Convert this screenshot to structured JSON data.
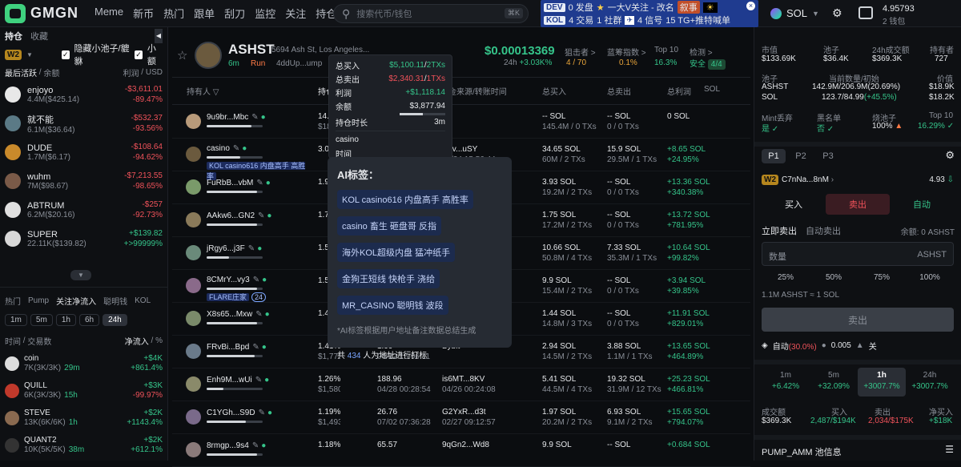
{
  "nav": {
    "brand": "GMGN",
    "items": [
      "Meme",
      "新币",
      "热门",
      "跟单",
      "刮刀",
      "监控",
      "关注",
      "持仓"
    ],
    "search_placeholder": "搜索代币/钱包",
    "search_kbd": "⌘K"
  },
  "promo": {
    "line1_tag": "DEV",
    "line1_a": "0 发盘",
    "line1_b": "一大V关注 - 改名",
    "line1_c": "叙事",
    "line2_tag": "KOL",
    "line2_a": "4 交易",
    "line2_b": "1 社群",
    "line2_c": "4 信号",
    "line2_d": "15 TG+推特喊单"
  },
  "chain": {
    "name": "SOL",
    "balance": "4.95793",
    "wallets": "2 钱包"
  },
  "left": {
    "tabs": [
      "持仓",
      "收藏"
    ],
    "wallet": "W2",
    "filter1": "隐藏小池子/貔貅",
    "filter2": "小额",
    "col1": "最后活跃",
    "col2": "余额",
    "col3": "利润",
    "col3b": "USD",
    "items": [
      {
        "name": "enjoyo",
        "sub": "4.4M($425.14)",
        "v1": "-$3,611.01",
        "v2": "-89.47%",
        "up": false
      },
      {
        "name": "就不能",
        "sub": "6.1M($36.64)",
        "v1": "-$532.37",
        "v2": "-93.56%",
        "up": false
      },
      {
        "name": "DUDE",
        "sub": "1.7M($6.17)",
        "v1": "-$108.64",
        "v2": "-94.62%",
        "up": false
      },
      {
        "name": "wuhm",
        "sub": "7M($98.67)",
        "v1": "-$7,213.55",
        "v2": "-98.65%",
        "up": false
      },
      {
        "name": "ABTRUM",
        "sub": "6.2M($20.16)",
        "v1": "-$257",
        "v2": "-92.73%",
        "up": false
      },
      {
        "name": "SUPER",
        "sub": "22.11K($139.82)",
        "v1": "+$139.82",
        "v2": "+>99999%",
        "up": true
      }
    ],
    "tabs2": [
      "热门",
      "Pump",
      "关注净流入",
      "聪明钱",
      "KOL"
    ],
    "times": [
      "1m",
      "5m",
      "1h",
      "6h",
      "24h"
    ],
    "col4": "时间",
    "col4b": "交易数",
    "col5": "净流入",
    "flows": [
      {
        "name": "coin",
        "sub": "7K(3K/3K)",
        "t": "29m",
        "v1": "+$4K",
        "v2": "+861.4%",
        "up": true
      },
      {
        "name": "QUILL",
        "sub": "6K(3K/3K)",
        "t": "15h",
        "v1": "+$3K",
        "v2": "-99.97%",
        "up": false
      },
      {
        "name": "STEVE",
        "sub": "13K(6K/6K)",
        "t": "1h",
        "v1": "+$2K",
        "v2": "+1143.4%",
        "up": true
      },
      {
        "name": "QUANT2",
        "sub": "10K(5K/5K)",
        "t": "38m",
        "v1": "+$2K",
        "v2": "+612.1%",
        "up": true
      }
    ]
  },
  "token": {
    "symbol": "ASHST",
    "addr": "5694 Ash St, Los Angeles...",
    "age": "6m",
    "run": "Run",
    "ca": "4ddUp...ump",
    "price": "$0.00013369",
    "change_label": "24h",
    "change": "+3.03K%",
    "sniper_label": "狙击者 >",
    "sniper": "4 / 70",
    "bluechip_label": "蓝筹指数 >",
    "bluechip": "0.1%",
    "top10_label": "Top 10",
    "top10": "16.3%",
    "check_label": "检测 >",
    "check": "安全",
    "check_count": "4/4"
  },
  "table": {
    "headers": [
      "持有人",
      "持仓",
      "金来源/转账时间",
      "总买入",
      "总卖出",
      "总利润",
      "SOL"
    ],
    "rows": [
      {
        "name": "9u9br...Mbc",
        "pct": "14.5",
        "usd": "$18",
        "src": "",
        "stime": "",
        "buy": "-- SOL",
        "buy2": "145.4M / 0 TXs",
        "sell": "-- SOL",
        "sell2": "0 / 0 TXs",
        "pnl": "0 SOL",
        "pnl2": "",
        "bar": 0.8
      },
      {
        "name": "casino",
        "pct": "3.04",
        "usd": "",
        "src": "Hev...uSY",
        "stime": "09/24 15:56:44",
        "buy": "34.65 SOL",
        "buy2": "60M / 2 TXs",
        "sell": "15.9 SOL",
        "sell2": "29.5M / 1 TXs",
        "pnl": "+8.65 SOL",
        "pnl2": "+24.95%",
        "bar": 0.6,
        "label": "KOL casino616 内盘高手 高胜率"
      },
      {
        "name": "FuRbB...vbM",
        "pct": "1.9",
        "usd": "",
        "src": "",
        "stime": "",
        "buy": "3.93 SOL",
        "buy2": "19.2M / 2 TXs",
        "sell": "-- SOL",
        "sell2": "0 / 0 TXs",
        "pnl": "+13.36 SOL",
        "pnl2": "+340.38%",
        "bar": 0.9
      },
      {
        "name": "AAkw6...GN2",
        "pct": "1.7",
        "usd": "",
        "src": "",
        "stime": "",
        "buy": "1.75 SOL",
        "buy2": "17.2M / 2 TXs",
        "sell": "-- SOL",
        "sell2": "0 / 0 TXs",
        "pnl": "+13.72 SOL",
        "pnl2": "+781.95%",
        "bar": 0.9
      },
      {
        "name": "jRgy6...j3F",
        "pct": "1.5",
        "usd": "",
        "src": "",
        "stime": "",
        "buy": "10.66 SOL",
        "buy2": "50.8M / 4 TXs",
        "sell": "7.33 SOL",
        "sell2": "35.3M / 1 TXs",
        "pnl": "+10.64 SOL",
        "pnl2": "+99.82%",
        "bar": 0.4
      },
      {
        "name": "8CMrY...vy3",
        "pct": "1.5",
        "usd": "",
        "src": "",
        "stime": "",
        "buy": "9.9 SOL",
        "buy2": "15.4M / 2 TXs",
        "sell": "-- SOL",
        "sell2": "0 / 0 TXs",
        "pnl": "+3.94 SOL",
        "pnl2": "+39.85%",
        "bar": 0.9,
        "label": "FLARE庄家",
        "badge": "24"
      },
      {
        "name": "X8s65...Mxw",
        "pct": "1.4",
        "usd": "",
        "src": "",
        "stime": "",
        "buy": "1.44 SOL",
        "buy2": "14.8M / 3 TXs",
        "sell": "-- SOL",
        "sell2": "0 / 0 TXs",
        "pnl": "+11.91 SOL",
        "pnl2": "+829.01%",
        "bar": 0.9
      },
      {
        "name": "FRvBi...Bpd",
        "pct": "1.41%",
        "usd": "$1,775.04",
        "amt": "1.99",
        "atime": "04/22 15:06:11",
        "src": "Bybit",
        "stime": "",
        "buy": "2.94 SOL",
        "buy2": "14.5M / 2 TXs",
        "sell": "3.88 SOL",
        "sell2": "1.1M / 1 TXs",
        "pnl": "+13.65 SOL",
        "pnl2": "+464.89%",
        "bar": 0.85
      },
      {
        "name": "Enh9M...wUi",
        "pct": "1.26%",
        "usd": "$1,580.14",
        "amt": "188.96",
        "atime": "04/28 00:28:54",
        "src": "is6MT...8KV",
        "stime": "04/26 00:24:08",
        "buy": "5.41 SOL",
        "buy2": "44.5M / 4 TXs",
        "sell": "19.32 SOL",
        "sell2": "31.9M / 12 TXs",
        "pnl": "+25.23 SOL",
        "pnl2": "+466.81%",
        "bar": 0.3
      },
      {
        "name": "C1YGh...S9D",
        "pct": "1.19%",
        "usd": "$1,493.21",
        "amt": "26.76",
        "atime": "07/02 07:36:28",
        "src": "G2YxR...d3t",
        "stime": "02/27 09:12:57",
        "buy": "1.97 SOL",
        "buy2": "20.2M / 2 TXs",
        "sell": "6.93 SOL",
        "sell2": "9.1M / 2 TXs",
        "pnl": "+15.65 SOL",
        "pnl2": "+794.07%",
        "bar": 0.7
      },
      {
        "name": "8rmgp...9s4",
        "pct": "1.18%",
        "usd": "",
        "amt": "65.57",
        "atime": "",
        "src": "9qGn2...Wd8",
        "stime": "",
        "buy": "9.9 SOL",
        "buy2": "",
        "sell": "-- SOL",
        "sell2": "",
        "pnl": "+0.684 SOL",
        "pnl2": "",
        "bar": 0.9
      }
    ]
  },
  "tip": {
    "buy_label": "总买入",
    "buy": "$5,100.11",
    "buy_tx": "2TXs",
    "sell_label": "总卖出",
    "sell": "$2,340.31",
    "sell_tx": "1TXs",
    "pnl_label": "利润",
    "pnl": "+$1,118.14",
    "bal_label": "余额",
    "bal": "$3,877.94",
    "hold_label": "持仓时长",
    "hold": "3m",
    "name": "casino",
    "time_label": "时间"
  },
  "popup": {
    "title": "AI标签：",
    "tags": [
      "KOL casino616 内盘高手 高胜率",
      "casino 畜生 砸盘哥 反指",
      "海外KOL超级内盘 猛冲纸手",
      "金狗王短线 快枪手 浇给",
      "MR_CASINO 聪明钱 波段"
    ],
    "note": "*AI标签根据用户地址备注数据总结生成",
    "footer_a": "共",
    "footer_n": "434",
    "footer_b": "人为地址进行打标"
  },
  "right": {
    "mcap_label": "市值",
    "mcap": "$133.69K",
    "pool_label": "池子",
    "pool": "$36.4K",
    "vol_label": "24h成交额",
    "vol": "$369.3K",
    "holders_label": "持有者",
    "holders": "727",
    "pool2_label": "池子",
    "cur_label": "当前数量/初始",
    "val_label": "价值",
    "t1": "ASHST",
    "t1q": "142.9M/206.9M(20.69%)",
    "t1v": "$18.9K",
    "t2": "SOL",
    "t2q": "123.7/84.99",
    "t2p": "(+45.5%)",
    "t2v": "$18.2K",
    "mint_label": "Mint丢弃",
    "mint": "是",
    "black_label": "黑名单",
    "black": "否",
    "burn_label": "烧池子",
    "burn": "100%",
    "top10_label": "Top 10",
    "top10": "16.29%",
    "presets": [
      "P1",
      "P2",
      "P3"
    ],
    "wallet": "W2",
    "wallet_addr": "C7nNa...8nM",
    "wallet_bal": "4.93",
    "modes": [
      "买入",
      "卖出",
      "自动"
    ],
    "sell_now": "立即卖出",
    "auto_sell": "自动卖出",
    "balance": "余额: 0 ASHST",
    "qty_placeholder": "数量",
    "qty_unit": "ASHST",
    "pcts": [
      "25%",
      "50%",
      "75%",
      "100%"
    ],
    "rate": "1.1M ASHST ≈ 1 SOL",
    "sell_btn": "卖出",
    "auto": "自动",
    "auto_pct": "(30.0%)",
    "fee": "0.005",
    "off": "关",
    "tf": [
      {
        "l": "1m",
        "v": "+6.42%"
      },
      {
        "l": "5m",
        "v": "+32.09%"
      },
      {
        "l": "1h",
        "v": "+3007.7%"
      },
      {
        "l": "24h",
        "v": "+3007.7%"
      }
    ],
    "s_vol_label": "成交额",
    "s_vol": "$369.3K",
    "s_buy_label": "买入",
    "s_buy": "2,487/$194K",
    "s_sell_label": "卖出",
    "s_sell": "2,034/$175K",
    "s_net_label": "净买入",
    "s_net": "+$18K",
    "amm": "PUMP_AMM 池信息"
  },
  "colors": {
    "green": "#35c48a",
    "red": "#f0525a",
    "accent": "#3fd17f",
    "promo": "#1f3b8f"
  }
}
